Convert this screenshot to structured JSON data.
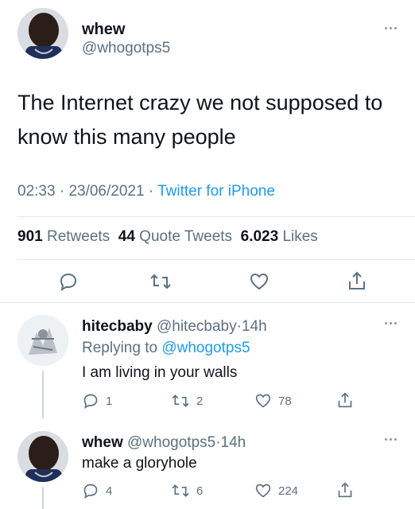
{
  "main_tweet": {
    "display_name": "whew",
    "handle": "@whogotps5",
    "text_line1": "The Internet crazy we not supposed to",
    "text_line2": "know this many people",
    "time": "02:33",
    "date": "23/06/2021",
    "source": "Twitter for iPhone",
    "retweets_count": "901",
    "retweets_label": "Retweets",
    "quote_count": "44",
    "quote_label": "Quote Tweets",
    "likes_count": "6.023",
    "likes_label": "Likes"
  },
  "replies": [
    {
      "display_name": "hitecbaby",
      "handle": "@hitecbaby",
      "age": "14h",
      "replying_prefix": "Replying to",
      "replying_to": "@whogotps5",
      "text": "I am living in your walls",
      "reply_count": "1",
      "retweet_count": "2",
      "like_count": "78"
    },
    {
      "display_name": "whew",
      "handle": "@whogotps5",
      "age": "14h",
      "text": "make a gloryhole",
      "reply_count": "4",
      "retweet_count": "6",
      "like_count": "224"
    }
  ],
  "separator": "·",
  "icons": [
    "more-icon",
    "reply-icon",
    "retweet-icon",
    "like-icon",
    "share-icon"
  ]
}
